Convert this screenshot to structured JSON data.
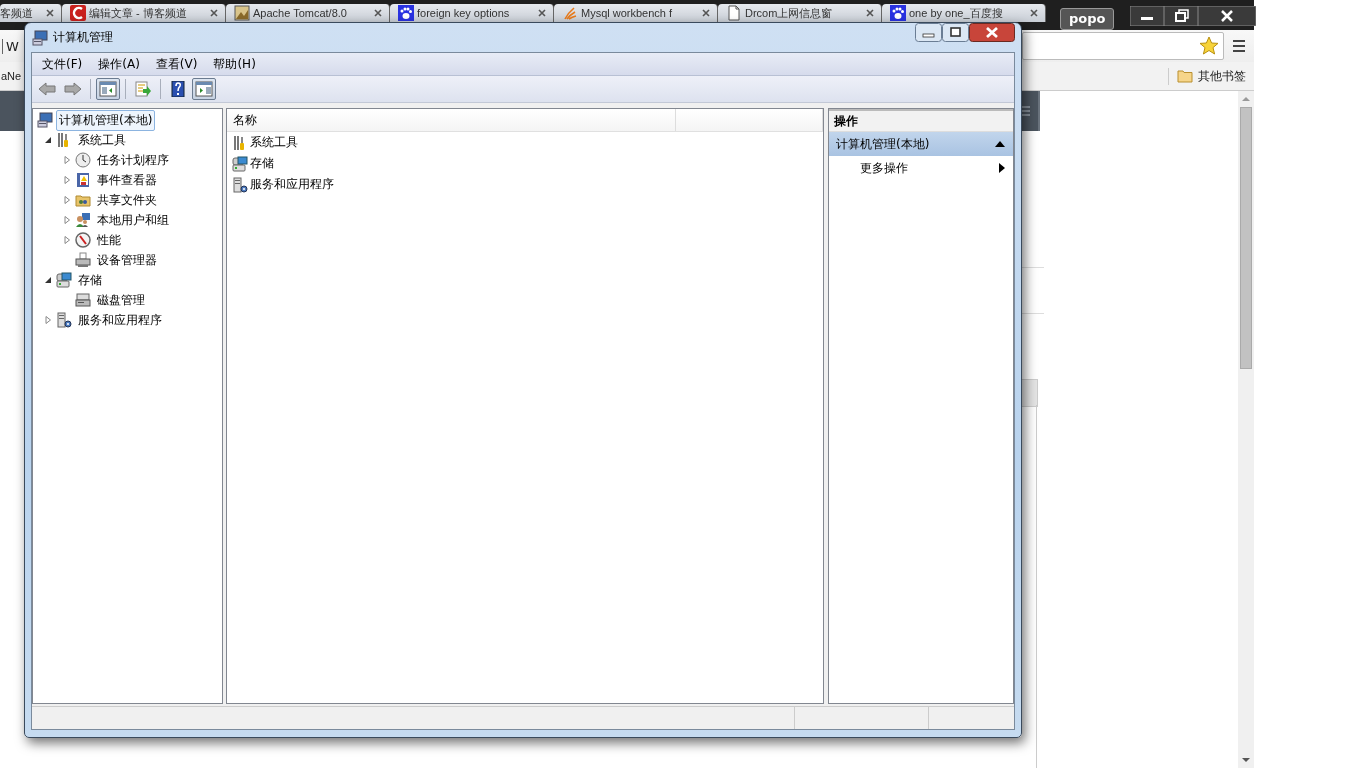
{
  "browser": {
    "tabs": [
      {
        "title": "客频道",
        "kind": "none",
        "selected": false
      },
      {
        "title": "编辑文章 - 博客频道",
        "kind": "red-c",
        "selected": false
      },
      {
        "title": "Apache Tomcat/8.0",
        "kind": "image",
        "selected": false
      },
      {
        "title": "foreign key options",
        "kind": "paw",
        "selected": false
      },
      {
        "title": "Mysql workbench f",
        "kind": "flame",
        "selected": false
      },
      {
        "title": "Drcom上网信息窗",
        "kind": "page",
        "selected": false
      },
      {
        "title": "one by one_百度搜",
        "kind": "paw",
        "selected": false
      }
    ],
    "profile": "popo",
    "address": "W",
    "bookmark_left": "aNe",
    "other_bookmarks": "其他书签"
  },
  "window": {
    "title": "计算机管理",
    "menu": [
      "文件(F)",
      "操作(A)",
      "查看(V)",
      "帮助(H)"
    ],
    "toolbar": [
      {
        "buttons": [
          {
            "kind": "back",
            "pressed": false
          },
          {
            "kind": "forward",
            "pressed": false
          }
        ]
      },
      {
        "buttons": [
          {
            "kind": "console-tree",
            "pressed": true
          }
        ]
      },
      {
        "buttons": [
          {
            "kind": "export",
            "pressed": false
          }
        ]
      },
      {
        "buttons": [
          {
            "kind": "help",
            "pressed": false
          },
          {
            "kind": "action-pane",
            "pressed": true
          }
        ]
      }
    ],
    "tree": [
      {
        "label": "计算机管理(本地)",
        "kind": "computer",
        "selected": true,
        "children": [
          {
            "label": "系统工具",
            "kind": "tools",
            "expanded": true,
            "selected": false,
            "children": [
              {
                "label": "任务计划程序",
                "kind": "clock",
                "expanded": false,
                "selected": false
              },
              {
                "label": "事件查看器",
                "kind": "log",
                "expanded": false,
                "selected": false
              },
              {
                "label": "共享文件夹",
                "kind": "share",
                "expanded": false,
                "selected": false
              },
              {
                "label": "本地用户和组",
                "kind": "users",
                "expanded": false,
                "selected": false
              },
              {
                "label": "性能",
                "kind": "gauge",
                "expanded": false,
                "selected": false
              },
              {
                "label": "设备管理器",
                "kind": "device",
                "selected": false
              }
            ]
          },
          {
            "label": "存储",
            "kind": "storage",
            "expanded": true,
            "selected": false,
            "children": [
              {
                "label": "磁盘管理",
                "kind": "disk",
                "selected": false
              }
            ]
          },
          {
            "label": "服务和应用程序",
            "kind": "services",
            "expanded": false,
            "selected": false
          }
        ]
      }
    ],
    "list": {
      "columns": [
        "名称"
      ],
      "rows": [
        {
          "label": "系统工具",
          "kind": "tools"
        },
        {
          "label": "存储",
          "kind": "storage"
        },
        {
          "label": "服务和应用程序",
          "kind": "services"
        }
      ]
    },
    "actions": {
      "title": "操作",
      "sections": [
        {
          "title": "计算机管理(本地)",
          "expanded": true,
          "items": [
            {
              "label": "更多操作",
              "submenu": true
            }
          ]
        }
      ]
    }
  }
}
